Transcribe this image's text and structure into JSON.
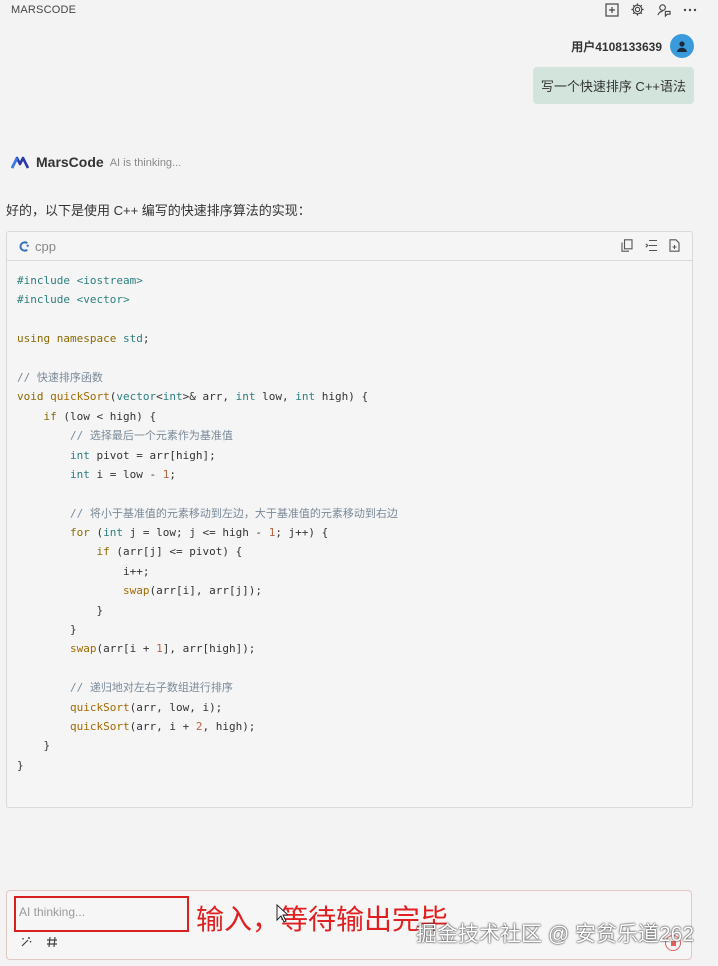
{
  "app": {
    "title": "MARSCODE"
  },
  "toolbar_icons": [
    "new-chat-icon",
    "settings-icon",
    "feedback-icon",
    "more-icon"
  ],
  "user": {
    "name": "用户4108133639",
    "message": "写一个快速排序 C++语法"
  },
  "bot": {
    "name": "MarsCode",
    "status": "AI is thinking...",
    "intro": "好的，以下是使用 C++ 编写的快速排序算法的实现："
  },
  "code": {
    "language": "cpp",
    "lines": [
      "#include <iostream>",
      "#include <vector>",
      "",
      "using namespace std;",
      "",
      "// 快速排序函数",
      "void quickSort(vector<int>& arr, int low, int high) {",
      "    if (low < high) {",
      "        // 选择最后一个元素作为基准值",
      "        int pivot = arr[high];",
      "        int i = low - 1;",
      "",
      "        // 将小于基准值的元素移动到左边，大于基准值的元素移动到右边",
      "        for (int j = low; j <= high - 1; j++) {",
      "            if (arr[j] <= pivot) {",
      "                i++;",
      "                swap(arr[i], arr[j]);",
      "            }",
      "        }",
      "        swap(arr[i + 1], arr[high]);",
      "",
      "        // 递归地对左右子数组进行排序",
      "        quickSort(arr, low, i);",
      "        quickSort(arr, i + 2, high);",
      "    }",
      "}"
    ]
  },
  "input": {
    "placeholder": "AI thinking..."
  },
  "annotation": {
    "text": "输入，等待输出完毕"
  },
  "watermark": {
    "text": "掘金技术社区 @ 安贫乐道262"
  },
  "colors": {
    "accent": "#3a9bdc",
    "user_bubble": "#d3e4dd",
    "annotation": "#e02020"
  }
}
